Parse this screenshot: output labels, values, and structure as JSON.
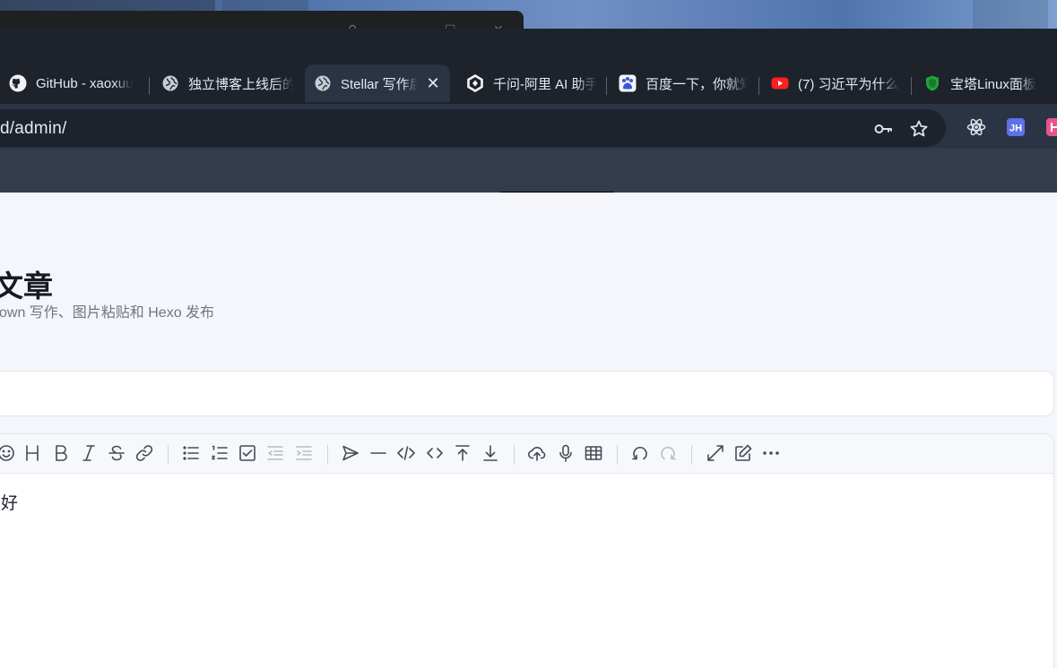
{
  "browser": {
    "tabs": [
      {
        "label": "GitHub - xaoxuu",
        "icon": "github-icon"
      },
      {
        "label": "独立博客上线后的",
        "icon": "globe-icon"
      },
      {
        "label": "Stellar 写作后台",
        "icon": "globe-icon",
        "active": true
      },
      {
        "label": "千问-阿里 AI 助手",
        "icon": "qwen-icon"
      },
      {
        "label": "百度一下，你就知道",
        "icon": "baidu-paw-icon"
      },
      {
        "label": "(7) 习近平为什么",
        "icon": "youtube-icon"
      },
      {
        "label": "宝塔Linux面板",
        "icon": "baota-shield-icon"
      }
    ],
    "url": "d/admin/",
    "toolbar_icons": [
      "password-key-icon",
      "bookmark-star-icon"
    ],
    "extensions": [
      "react-devtools-icon",
      "jh-extension-icon",
      "pink-extension-icon"
    ]
  },
  "page": {
    "heading": "新文章",
    "subtitle": "own 写作、图片粘贴和 Hexo 发布",
    "title_value": "",
    "editor_content": "你好",
    "editor_toolbar": [
      "emoji-icon",
      "heading-icon",
      "bold-icon",
      "italic-icon",
      "strike-icon",
      "link-icon",
      "unordered-list-icon",
      "ordered-list-icon",
      "check-list-icon",
      "outdent-icon",
      "indent-icon",
      "quote-icon",
      "horizontal-rule-icon",
      "code-icon",
      "inline-code-icon",
      "insert-before-icon",
      "insert-after-icon",
      "upload-icon",
      "record-icon",
      "table-icon",
      "undo-icon",
      "redo-icon",
      "fullscreen-icon",
      "edit-mode-icon",
      "more-icon"
    ]
  }
}
